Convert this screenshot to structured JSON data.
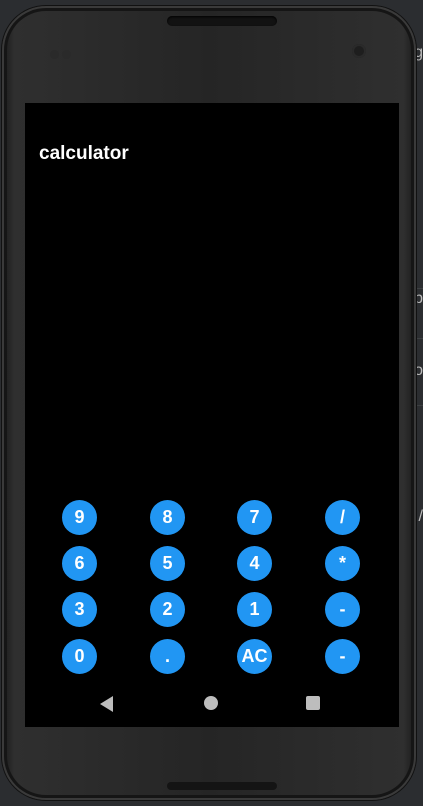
{
  "app": {
    "title": "calculator"
  },
  "keypad": {
    "rows": [
      [
        "9",
        "8",
        "7",
        "/"
      ],
      [
        "6",
        "5",
        "4",
        "*"
      ],
      [
        "3",
        "2",
        "1",
        "-"
      ],
      [
        "0",
        ".",
        "AC",
        "-"
      ]
    ]
  },
  "colors": {
    "screen_bg": "#000000",
    "key_bg": "#2196f3",
    "key_text": "#ffffff",
    "title_text": "#ffffff"
  },
  "background": {
    "edge_chars": [
      "g",
      "p",
      "o",
      "/"
    ]
  }
}
